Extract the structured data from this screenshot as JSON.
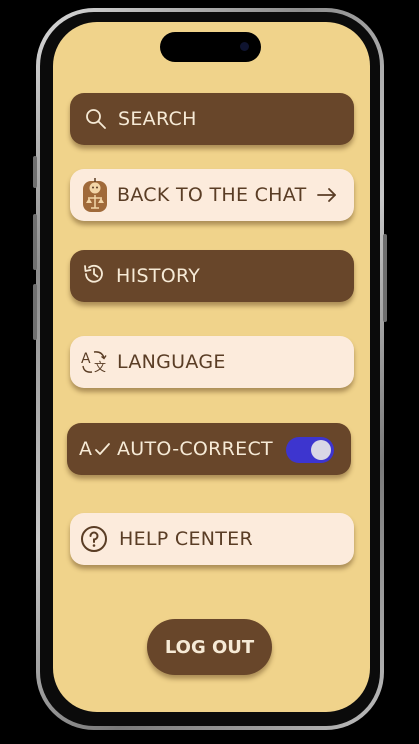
{
  "menu": {
    "search_label": "SEARCH",
    "back_to_chat_label": "BACK TO THE CHAT",
    "history_label": "HISTORY",
    "language_label": "LANGUAGE",
    "auto_correct_label": "AUTO-CORRECT",
    "auto_correct_enabled": true,
    "help_center_label": "HELP CENTER",
    "logout_label": "LOG OUT"
  },
  "icons": {
    "search": "search-icon",
    "back_to_chat": "robot-judge-icon",
    "arrow": "arrow-right-icon",
    "history": "history-icon",
    "language": "translate-icon",
    "auto_correct": "spellcheck-icon",
    "help": "question-circle-icon"
  },
  "colors": {
    "background": "#f0d38b",
    "dark_button": "#68462a",
    "light_button": "#fcebdc",
    "toggle_on": "#3d35cf"
  }
}
